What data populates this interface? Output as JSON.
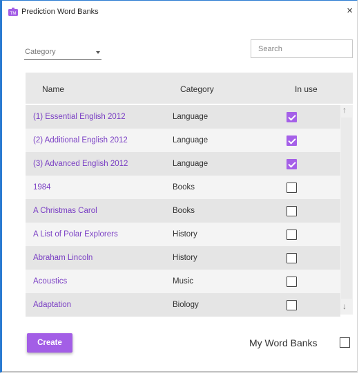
{
  "window": {
    "title": "Prediction Word Banks",
    "close_symbol": "×"
  },
  "filters": {
    "category_label": "Category",
    "search_placeholder": "Search"
  },
  "table": {
    "headers": {
      "name": "Name",
      "category": "Category",
      "in_use": "In use"
    },
    "rows": [
      {
        "name": "(1) Essential English 2012",
        "category": "Language",
        "in_use": true
      },
      {
        "name": "(2) Additional English 2012",
        "category": "Language",
        "in_use": true
      },
      {
        "name": "(3) Advanced English 2012",
        "category": "Language",
        "in_use": true
      },
      {
        "name": "1984",
        "category": "Books",
        "in_use": false
      },
      {
        "name": "A Christmas Carol",
        "category": "Books",
        "in_use": false
      },
      {
        "name": "A List of Polar Explorers",
        "category": "History",
        "in_use": false
      },
      {
        "name": "Abraham Lincoln",
        "category": "History",
        "in_use": false
      },
      {
        "name": "Acoustics",
        "category": "Music",
        "in_use": false
      },
      {
        "name": "Adaptation",
        "category": "Biology",
        "in_use": false
      }
    ]
  },
  "scrollbar": {
    "up_symbol": "↑",
    "down_symbol": "↓"
  },
  "footer": {
    "create_label": "Create",
    "my_word_banks_label": "My Word Banks",
    "my_word_banks_checked": false
  },
  "colors": {
    "accent": "#a35ee6",
    "link": "#7a3fc4",
    "window_border": "#2b7bd1"
  },
  "icons": {
    "app": "app-puzzle-icon",
    "close": "close-icon",
    "dropdown": "chevron-down-icon"
  }
}
